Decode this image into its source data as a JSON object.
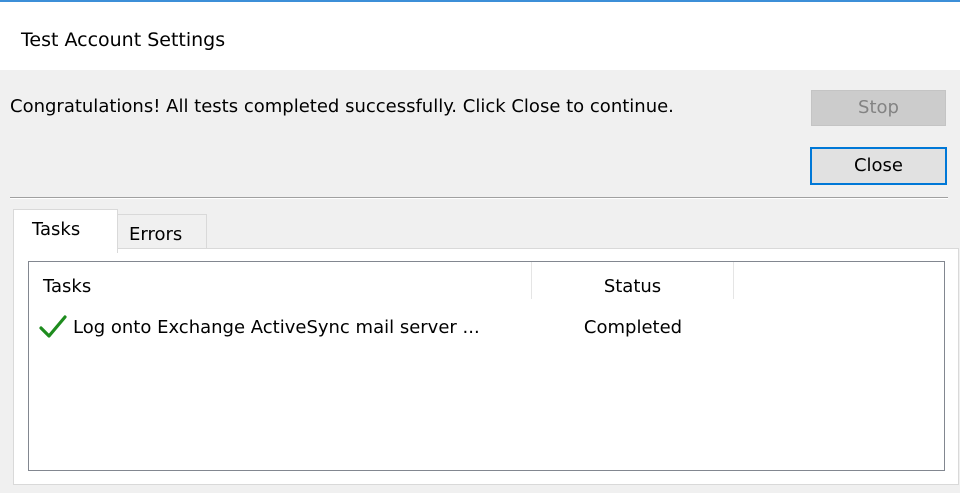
{
  "window": {
    "title": "Test Account Settings"
  },
  "message": "Congratulations! All tests completed successfully. Click Close to continue.",
  "buttons": {
    "stop_label": "Stop",
    "close_label": "Close"
  },
  "tabs": [
    {
      "label": "Tasks",
      "selected": true
    },
    {
      "label": "Errors",
      "selected": false
    }
  ],
  "table": {
    "columns": [
      "Tasks",
      "Status",
      ""
    ],
    "rows": [
      {
        "icon": "checkmark-icon",
        "task": "Log onto Exchange ActiveSync mail server ...",
        "status": "Completed"
      }
    ]
  },
  "colors": {
    "accent": "#0078d7",
    "success": "#1e8c1e",
    "dialog_background": "#f0f0f0"
  }
}
